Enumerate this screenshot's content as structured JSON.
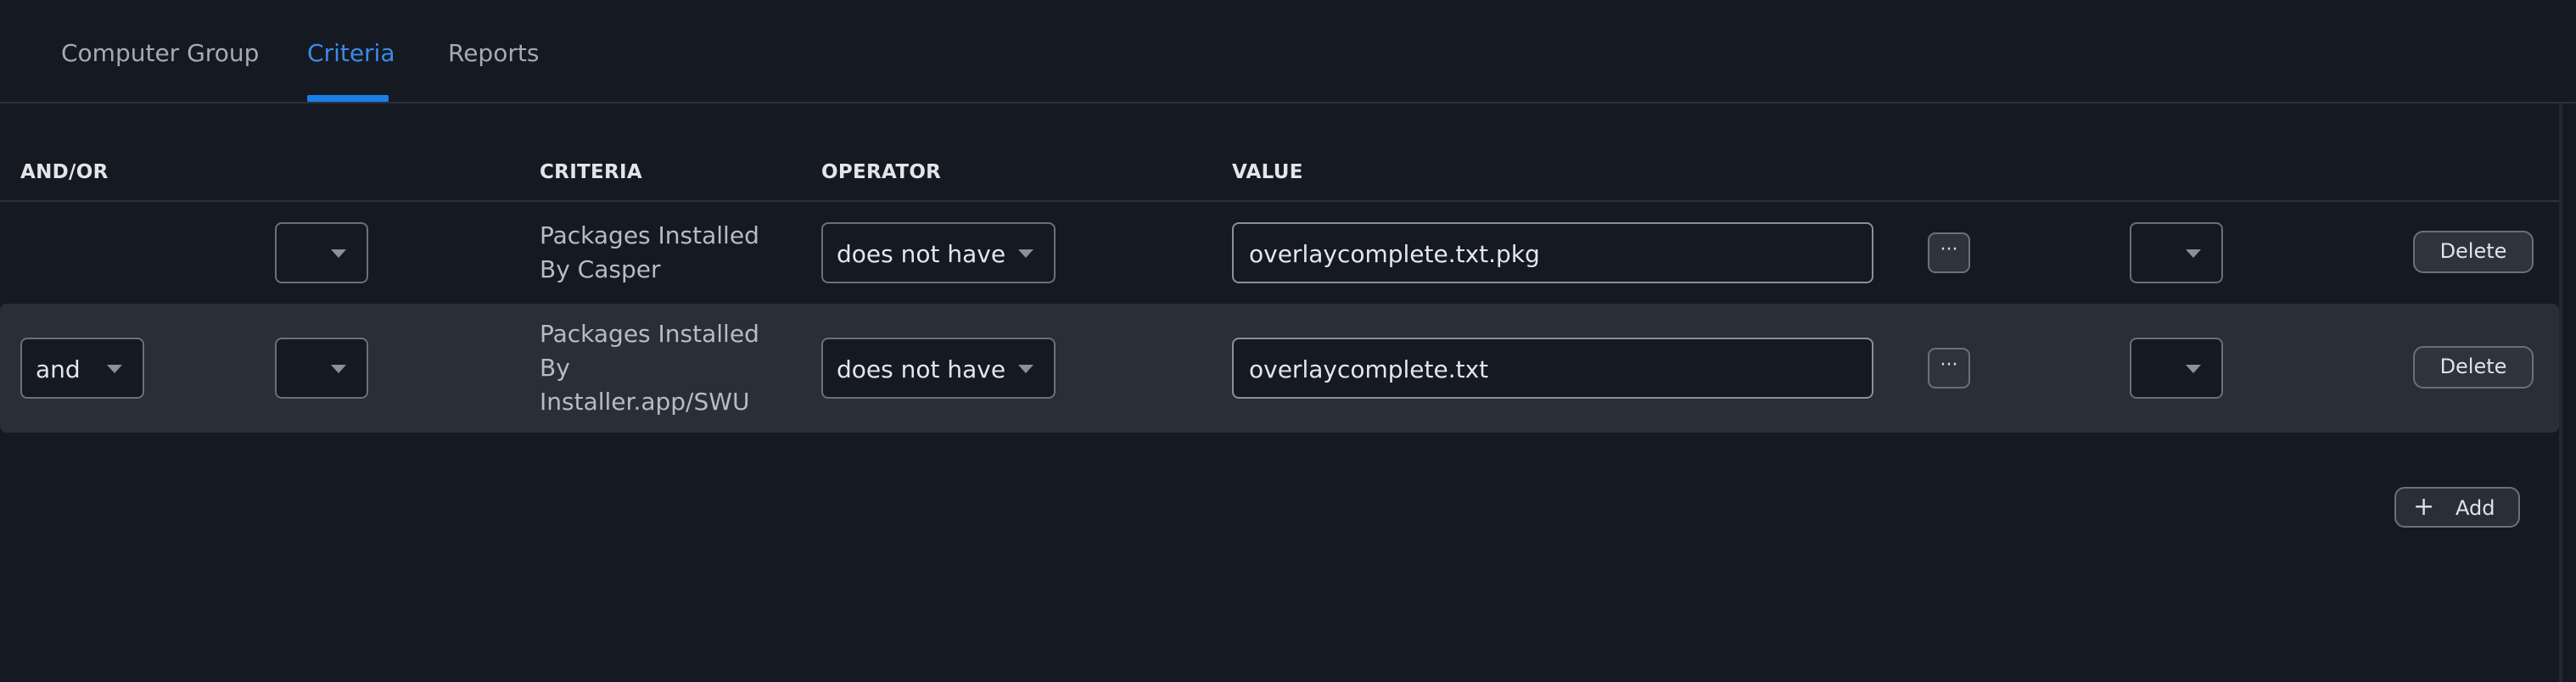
{
  "tabs": [
    {
      "label": "Computer Group",
      "active": false
    },
    {
      "label": "Criteria",
      "active": true
    },
    {
      "label": "Reports",
      "active": false
    }
  ],
  "table": {
    "headers": {
      "and_or": "AND/OR",
      "criteria": "CRITERIA",
      "operator": "OPERATOR",
      "value": "VALUE"
    },
    "rows": [
      {
        "and_or": "",
        "open_paren": "",
        "criteria_lines": [
          "Packages Installed",
          "By Casper"
        ],
        "operator": "does not have",
        "value": "overlaycomplete.txt.pkg",
        "close_paren": "",
        "browse_label": "···",
        "delete_label": "Delete"
      },
      {
        "and_or": "and",
        "open_paren": "",
        "criteria_lines": [
          "Packages Installed",
          "By",
          "Installer.app/SWU"
        ],
        "operator": "does not have",
        "value": "overlaycomplete.txt",
        "close_paren": "",
        "browse_label": "···",
        "delete_label": "Delete"
      }
    ]
  },
  "add_button": {
    "icon": "plus-icon",
    "label": "Add"
  },
  "colors": {
    "background": "#151922",
    "accent": "#1c7fe8",
    "row_highlight": "#2a2e36"
  }
}
